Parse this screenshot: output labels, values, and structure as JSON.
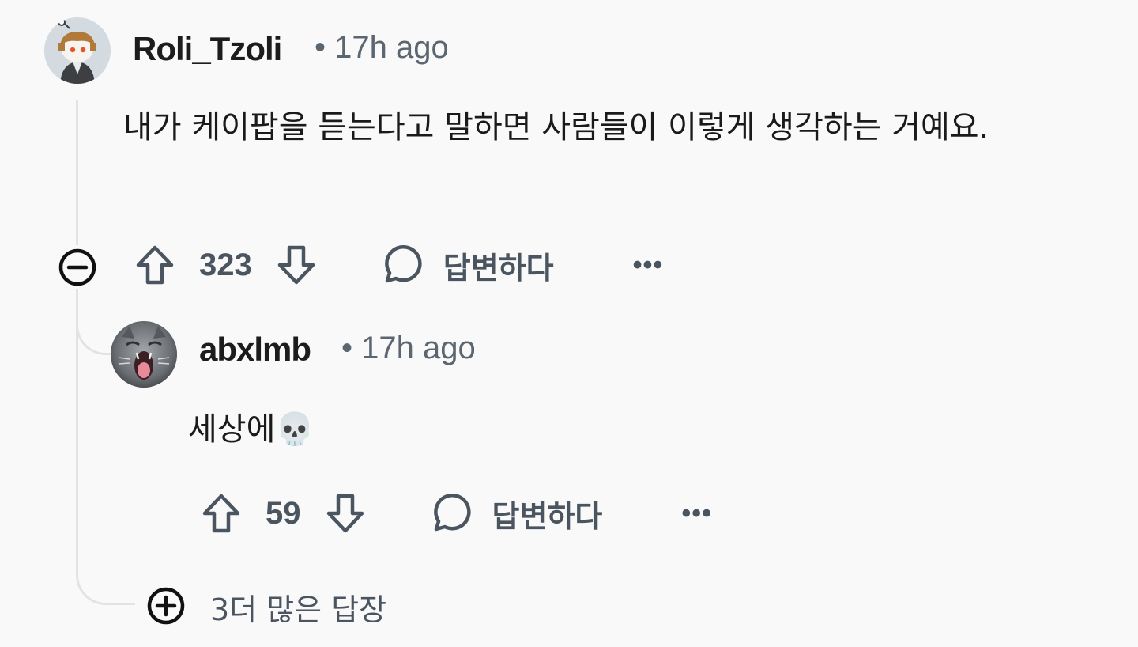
{
  "comment": {
    "author": "Roli_Tzoli",
    "meta": "• 17h ago",
    "text": "내가 케이팝을 듣는다고 말하면 사람들이 이렇게 생각하는 거예요.",
    "votes": "323",
    "reply_label": "답변하다",
    "more_label": "•••",
    "collapse_icon": "minus-circle-icon"
  },
  "reply": {
    "author": "abxlmb",
    "meta": "• 17h ago",
    "text": "세상에💀",
    "votes": "59",
    "reply_label": "답변하다",
    "more_label": "•••"
  },
  "more_replies": {
    "label": "3더 많은 답장",
    "expand_icon": "plus-circle-icon"
  },
  "colors": {
    "background": "#f9f9fa",
    "thread_line": "#e1e3e6",
    "muted_text": "#5c6670",
    "action_text": "#4a5560"
  }
}
